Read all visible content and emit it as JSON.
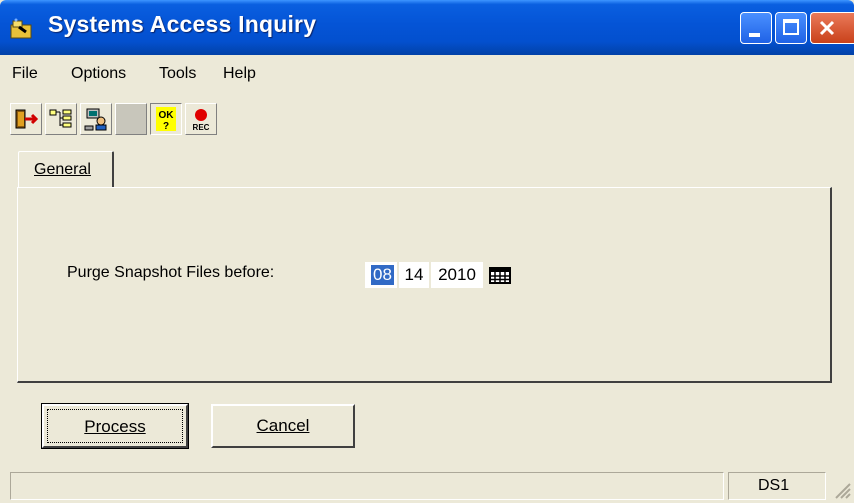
{
  "window": {
    "title": "Systems Access Inquiry"
  },
  "menu": {
    "items": [
      "File",
      "Options",
      "Tools",
      "Help"
    ]
  },
  "toolbar": {
    "buttons": [
      {
        "name": "exit-icon"
      },
      {
        "name": "tree-icon"
      },
      {
        "name": "users-icon"
      },
      {
        "name": "blank-icon"
      },
      {
        "name": "ok-help-icon",
        "text": "OK"
      },
      {
        "name": "record-icon",
        "text": "REC"
      }
    ]
  },
  "tabs": [
    {
      "label": "General",
      "active": true
    }
  ],
  "form": {
    "purge_label": "Purge Snapshot Files before:",
    "date": {
      "month": "08",
      "day": "14",
      "year": "2010"
    }
  },
  "buttons": {
    "process": "Process",
    "cancel": "Cancel"
  },
  "status": {
    "main": "",
    "server": "DS1"
  },
  "colors": {
    "title_bar": "#0454d6",
    "window_bg": "#ece9d8",
    "selection": "#316ac5"
  }
}
